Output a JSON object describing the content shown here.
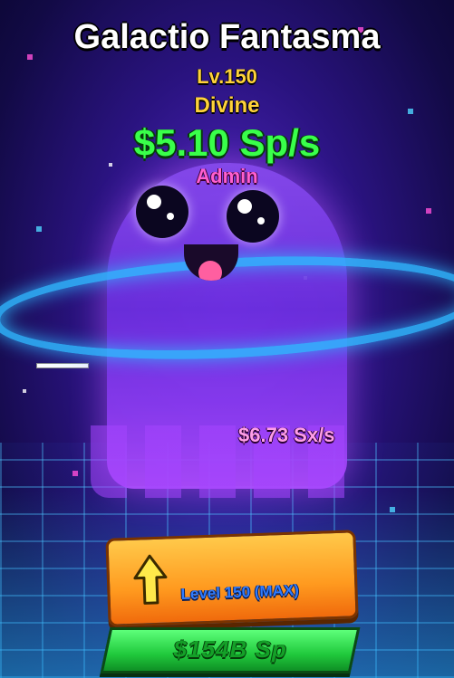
{
  "pet": {
    "name": "Galactio Fantasma",
    "level": "Lv.150",
    "rarity": "Divine",
    "rate": "$5.10 Sp/s",
    "owner": "Admin",
    "floating_rate": "$6.73 Sx/s"
  },
  "upgrade": {
    "label": "Level 150 (MAX)",
    "icon": "arrow-up-icon"
  },
  "cost": {
    "label": "$154B Sp"
  },
  "colors": {
    "level_text": "#ffd23a",
    "rate_text": "#39ff4a",
    "owner_text": "#ff5fd0",
    "upgrade_button": "#ff9a1f",
    "cost_button": "#20c93c",
    "ring": "#2fb8ff"
  }
}
